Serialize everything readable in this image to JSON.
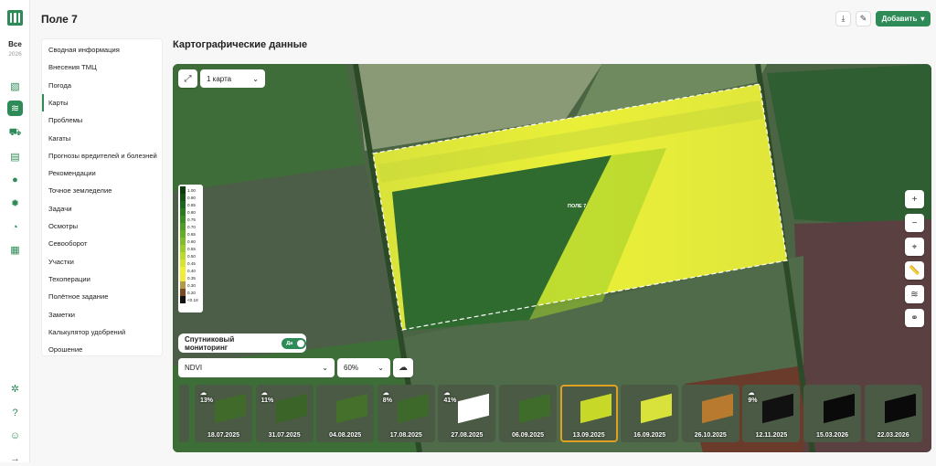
{
  "rail": {
    "season_label": "Все",
    "season_year": "2026"
  },
  "header": {
    "title": "Поле 7",
    "add_label": "Добавить"
  },
  "menu": {
    "items": [
      "Сводная информация",
      "Внесения ТМЦ",
      "Погода",
      "Карты",
      "Проблемы",
      "Кагаты",
      "Прогнозы вредителей и болезней",
      "Рекомендации",
      "Точное земледелие",
      "Задачи",
      "Осмотры",
      "Севооборот",
      "Участки",
      "Техоперации",
      "Полётное задание",
      "Заметки",
      "Калькулятор удобрений",
      "Орошение"
    ],
    "active": "Карты"
  },
  "section": {
    "title": "Картографические данные"
  },
  "map": {
    "map_count": "1 карта",
    "field_label": "ПОЛЕ 7",
    "layer": "NDVI",
    "opacity": "60%",
    "monitoring_label": "Спутниковый мониторинг",
    "toggle_label": "Да",
    "legend": [
      {
        "label": "1.00",
        "color": "#0a3d0a"
      },
      {
        "label": "0.90",
        "color": "#145214"
      },
      {
        "label": "0.85",
        "color": "#1d661d"
      },
      {
        "label": "0.80",
        "color": "#2a7a1e"
      },
      {
        "label": "0.75",
        "color": "#3b8c22"
      },
      {
        "label": "0.70",
        "color": "#4f9d24"
      },
      {
        "label": "0.65",
        "color": "#66ad26"
      },
      {
        "label": "0.60",
        "color": "#80bd28"
      },
      {
        "label": "0.55",
        "color": "#9ccc2a"
      },
      {
        "label": "0.50",
        "color": "#bada2c"
      },
      {
        "label": "0.45",
        "color": "#d6e62e"
      },
      {
        "label": "0.40",
        "color": "#eef034"
      },
      {
        "label": "0.35",
        "color": "#f2ea3a"
      },
      {
        "label": "0.30",
        "color": "#b29a4a"
      },
      {
        "label": "0.20",
        "color": "#7a4a22"
      },
      {
        "label": "<0.18",
        "color": "#111111"
      }
    ]
  },
  "thumbnails": [
    {
      "date": "18.07.2025",
      "cloud": "13%",
      "fill": "#3f6a2a"
    },
    {
      "date": "31.07.2025",
      "cloud": "11%",
      "fill": "#3a6428"
    },
    {
      "date": "04.08.2025",
      "cloud": "",
      "fill": "#44702c"
    },
    {
      "date": "17.08.2025",
      "cloud": "8%",
      "fill": "#3d6a2a"
    },
    {
      "date": "27.08.2025",
      "cloud": "41%",
      "fill": "#ffffff"
    },
    {
      "date": "06.09.2025",
      "cloud": "",
      "fill": "#3f6c2b"
    },
    {
      "date": "13.09.2025",
      "cloud": "",
      "fill": "#c8d829",
      "selected": true
    },
    {
      "date": "16.09.2025",
      "cloud": "",
      "fill": "#d8e23a"
    },
    {
      "date": "26.10.2025",
      "cloud": "",
      "fill": "#b77a2e"
    },
    {
      "date": "12.11.2025",
      "cloud": "9%",
      "fill": "#111111"
    },
    {
      "date": "15.03.2026",
      "cloud": "",
      "fill": "#0a0a0a"
    },
    {
      "date": "22.03.2026",
      "cloud": "",
      "fill": "#0a0a0a"
    }
  ]
}
